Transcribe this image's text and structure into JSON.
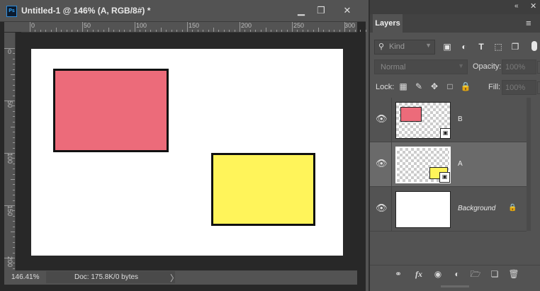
{
  "document": {
    "app_icon": "Ps",
    "title": "Untitled-1 @ 146% (A, RGB/8#) *",
    "window_buttons": {
      "minimize": "▁",
      "maximize": "❐",
      "close": "✕"
    },
    "horizontal_ruler_labels": [
      "0",
      "50",
      "100",
      "150",
      "200",
      "250",
      "300"
    ],
    "vertical_ruler_labels": [
      "0",
      "50",
      "100",
      "150",
      "200"
    ],
    "shapes": [
      {
        "name": "B",
        "fill": "#ec6b7a"
      },
      {
        "name": "A",
        "fill": "#fff45a"
      }
    ],
    "status": {
      "zoom": "146.41%",
      "doc_size": "Doc: 175.8K/0 bytes",
      "arrow": "〉"
    }
  },
  "layers_panel": {
    "collapse_icon": "«",
    "close_icon": "✕",
    "tab_label": "Layers",
    "menu_icon": "≡",
    "filter": {
      "search_icon": "⚲",
      "placeholder": "Kind",
      "icons": [
        "image-filter-icon",
        "adjustment-filter-icon",
        "type-filter-icon",
        "shape-filter-icon",
        "smart-object-filter-icon"
      ]
    },
    "blend_mode": "Normal",
    "opacity_label": "Opacity:",
    "opacity_value": "100%",
    "lock_label": "Lock:",
    "fill_label": "Fill:",
    "fill_value": "100%",
    "layers": [
      {
        "name": "B",
        "visible": true,
        "selected": false,
        "smart_object": true,
        "thumb_fill": "#ec6b7a"
      },
      {
        "name": "A",
        "visible": true,
        "selected": true,
        "smart_object": true,
        "thumb_fill": "#fff45a"
      },
      {
        "name": "Background",
        "visible": true,
        "selected": false,
        "locked": true,
        "thumb_fill": "#ffffff"
      }
    ],
    "bottom_icons": [
      "link-layers-icon",
      "fx-icon",
      "add-mask-icon",
      "adjustment-layer-icon",
      "new-group-icon",
      "new-layer-icon",
      "delete-layer-icon"
    ]
  },
  "colors": {
    "panel_bg": "#535353",
    "canvas_bg": "#282828",
    "selected_row": "#6a6a6a",
    "accent": "#31a8ff"
  }
}
